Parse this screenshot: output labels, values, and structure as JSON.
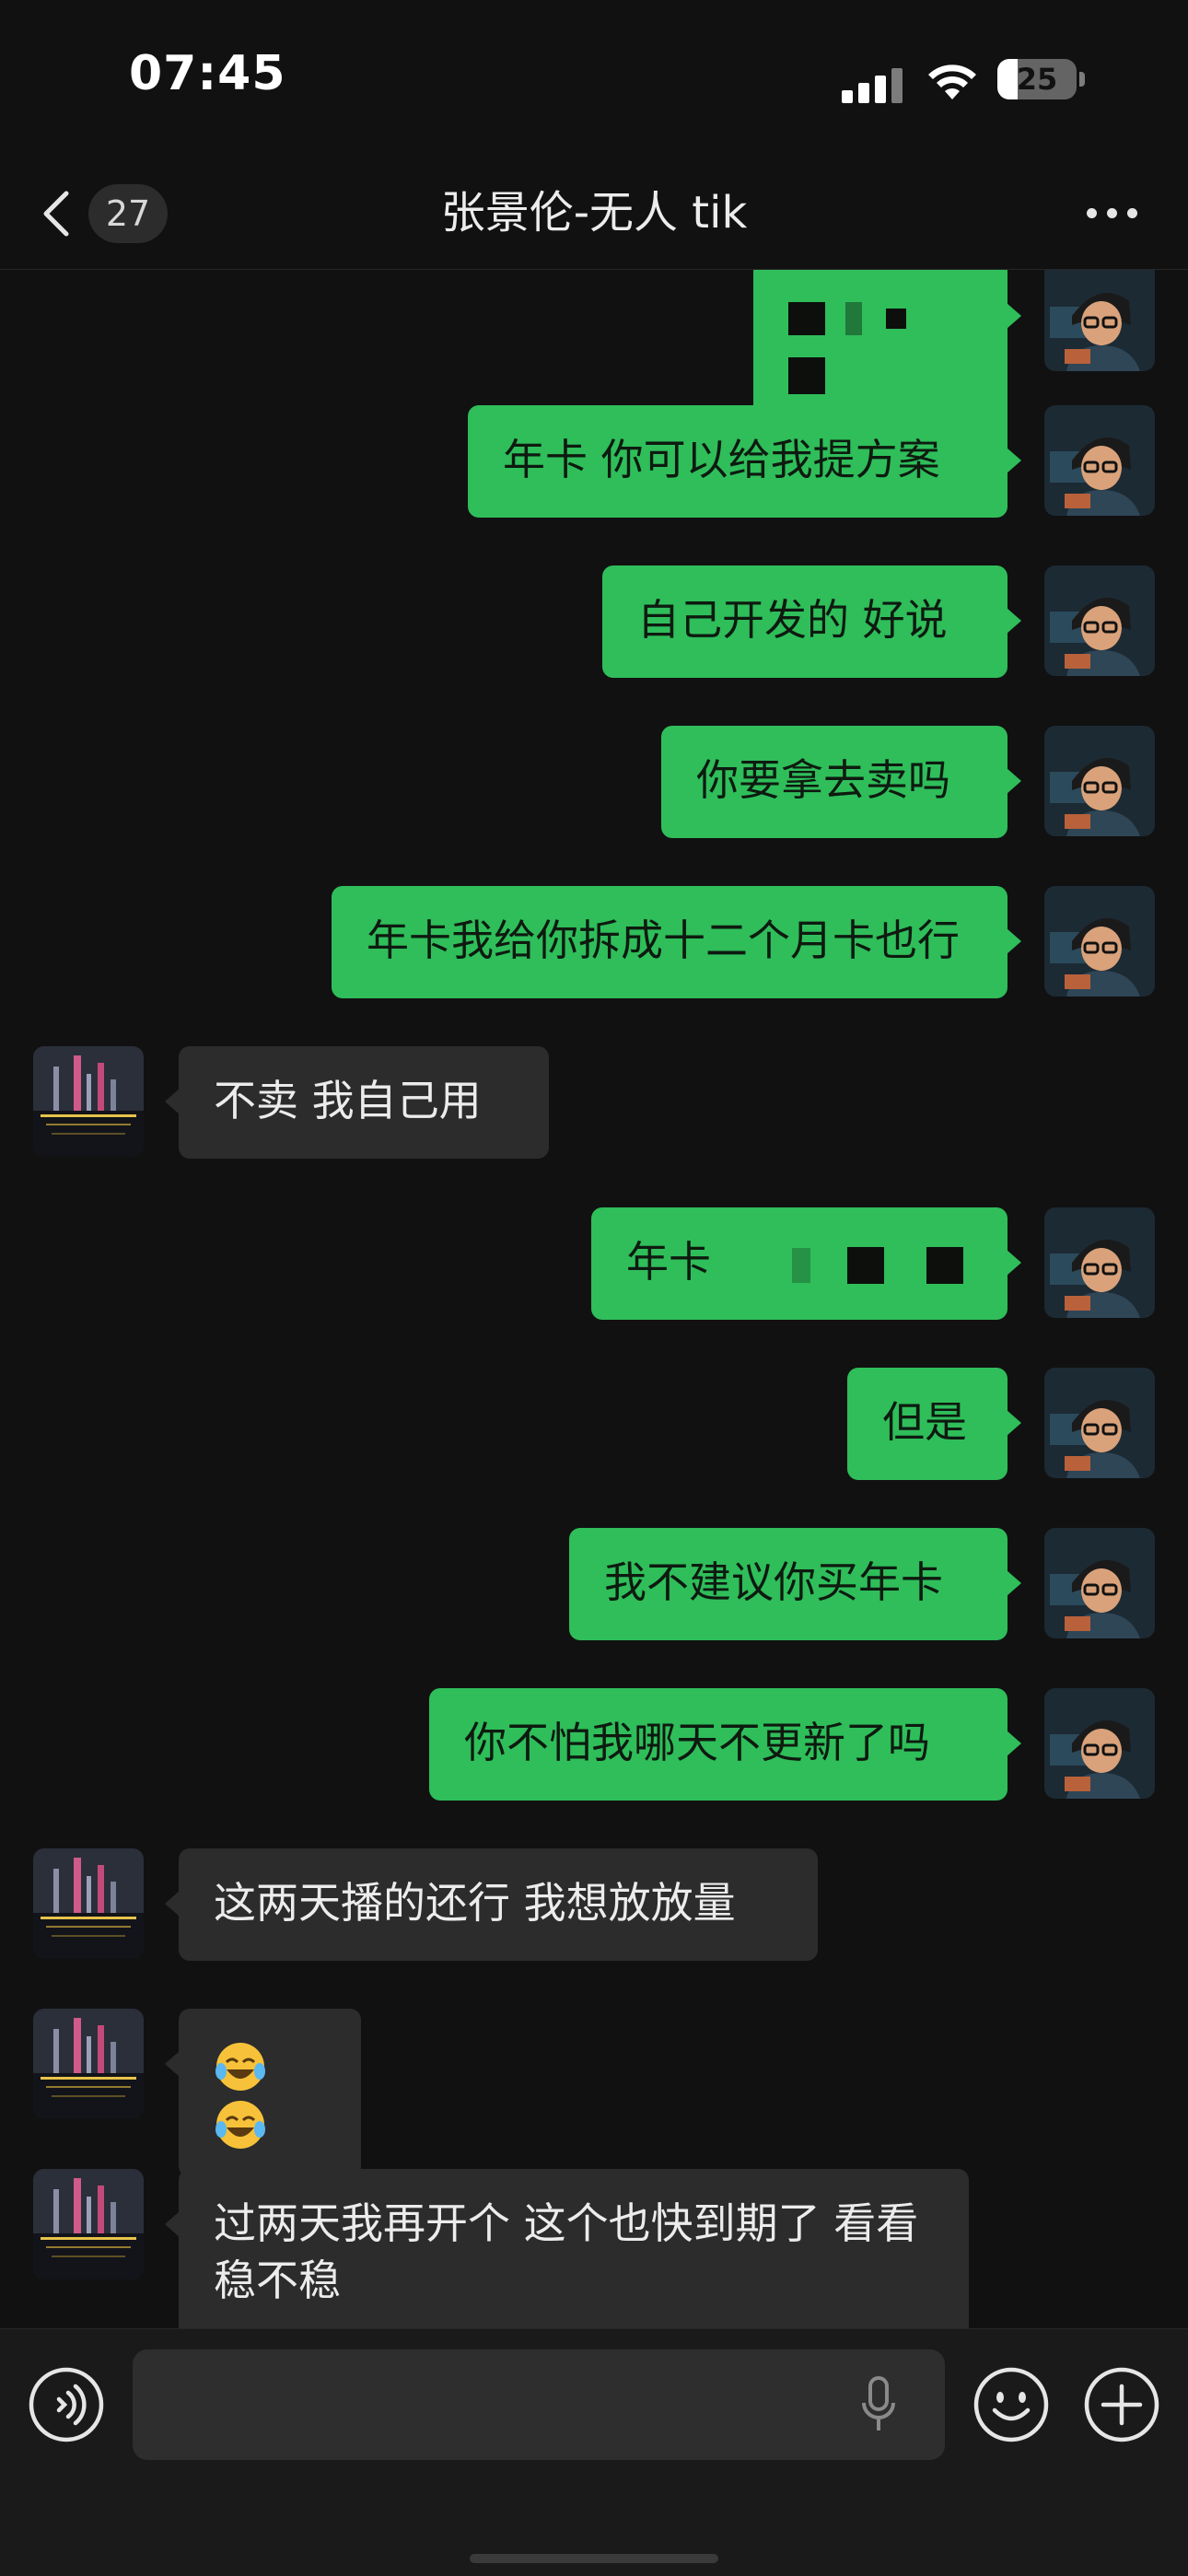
{
  "status_bar": {
    "time": "07:45",
    "battery_level": "25"
  },
  "header": {
    "unread_count": "27",
    "title": "张景伦-无人 tik"
  },
  "messages": [
    {
      "side": "me",
      "text": "",
      "redacted": true
    },
    {
      "side": "me",
      "text": "年卡 你可以给我提方案"
    },
    {
      "side": "me",
      "text": "自己开发的 好说"
    },
    {
      "side": "me",
      "text": "你要拿去卖吗"
    },
    {
      "side": "me",
      "text": "年卡我给你拆成十二个月卡也行"
    },
    {
      "side": "peer",
      "text": "不卖 我自己用"
    },
    {
      "side": "me",
      "text": "年卡",
      "redacted": true
    },
    {
      "side": "me",
      "text": "但是"
    },
    {
      "side": "me",
      "text": "我不建议你买年卡"
    },
    {
      "side": "me",
      "text": "你不怕我哪天不更新了吗"
    },
    {
      "side": "peer",
      "text": "这两天播的还行 我想放放量"
    },
    {
      "side": "peer",
      "text": "",
      "emoji": [
        "face-with-tears-of-joy",
        "face-with-tears-of-joy"
      ]
    },
    {
      "side": "peer",
      "text": "过两天我再开个 这个也快到期了 看看稳不稳"
    }
  ],
  "colors": {
    "background": "#111111",
    "outgoing_bubble": "#2fbe5a",
    "incoming_bubble": "#2c2c2c",
    "input_bar": "#1a1a1a"
  },
  "icons": {
    "back": "chevron-left-icon",
    "more": "more-dots-icon",
    "voice": "voice-icon",
    "mic": "microphone-icon",
    "emoji": "smiley-icon",
    "plus": "plus-icon"
  }
}
